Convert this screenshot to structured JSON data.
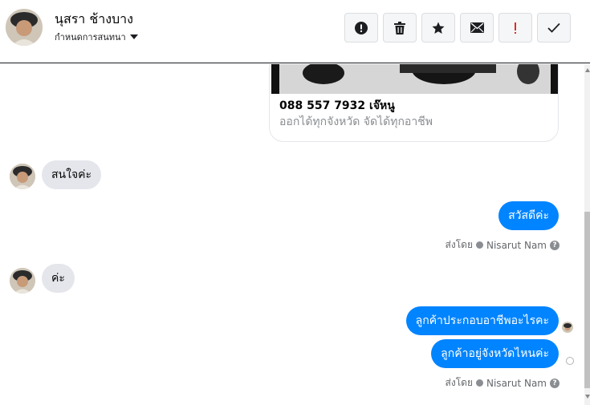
{
  "header": {
    "contact_name": "นุสรา ช้างบาง",
    "assign_label": "กำหนดการสนทนา",
    "toolbar": [
      {
        "icon": "alert-circle-icon",
        "color": "#1c1e21"
      },
      {
        "icon": "trash-icon",
        "color": "#1c1e21"
      },
      {
        "icon": "star-icon",
        "color": "#1c1e21"
      },
      {
        "icon": "envelope-icon",
        "color": "#1c1e21"
      },
      {
        "icon": "exclamation-icon",
        "color": "#d93025"
      },
      {
        "icon": "check-icon",
        "color": "#1c1e21"
      }
    ]
  },
  "thread": {
    "card": {
      "title": "088 557 7932 เจ๊หนู",
      "subtitle": "ออกได้ทุกจังหวัด จัดได้ทุกอาชีพ"
    },
    "messages": [
      {
        "direction": "in",
        "text": "สนใจค่ะ"
      },
      {
        "direction": "out",
        "text": "สวัสดีค่ะ"
      },
      {
        "direction": "in",
        "text": "ค่ะ"
      },
      {
        "direction": "out",
        "text": "ลูกค้าประกอบอาชีพอะไรคะ"
      },
      {
        "direction": "out",
        "text": "ลูกค้าอยู่จังหวัดไหนค่ะ"
      }
    ],
    "sent_by_label": "ส่งโดย",
    "sent_by_name": "Nisarut Nam",
    "help_glyph": "?"
  },
  "colors": {
    "outgoing_bubble": "#0084ff",
    "incoming_bubble": "#e4e6eb",
    "meta_text": "#65676b"
  }
}
